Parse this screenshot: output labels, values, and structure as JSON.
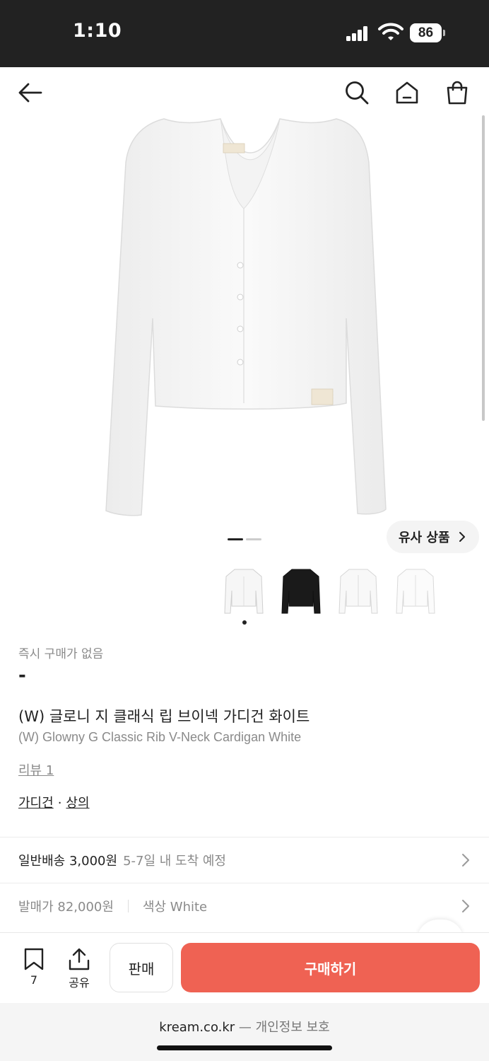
{
  "status_bar": {
    "time": "1:10",
    "battery": "86"
  },
  "nav": {
    "back_icon": "arrow-left-icon",
    "search_icon": "search-icon",
    "home_icon": "home-icon",
    "cart_icon": "shopping-bag-icon"
  },
  "gallery": {
    "similar_products_label": "유사 상품",
    "page_index": 1,
    "page_count": 2,
    "selected_thumbnail": 0
  },
  "product": {
    "instant_buy_label": "즉시 구매가 없음",
    "price": "-",
    "title_ko": "(W) 글로니 지 클래식 립 브이넥 가디건 화이트",
    "title_en": "(W) Glowny G Classic Rib V-Neck Cardigan White",
    "review_link": "리뷰 1",
    "categories": [
      "가디건",
      "상의"
    ],
    "category_separator": "·"
  },
  "shipping": {
    "main": "일반배송 3,000원",
    "sub": "5-7일 내 도착 예정"
  },
  "details": {
    "release_price": "발매가 82,000원",
    "color": "색상 White"
  },
  "actions": {
    "bookmark_count": "7",
    "share_label": "공유",
    "sell_label": "판매",
    "buy_label": "구매하기"
  },
  "browser": {
    "domain": "kream.co.kr",
    "privacy": " — 개인정보 보호"
  },
  "colors": {
    "buy_button": "#ef6253",
    "status_bar": "#222222",
    "muted_text": "#8a8a8a"
  }
}
